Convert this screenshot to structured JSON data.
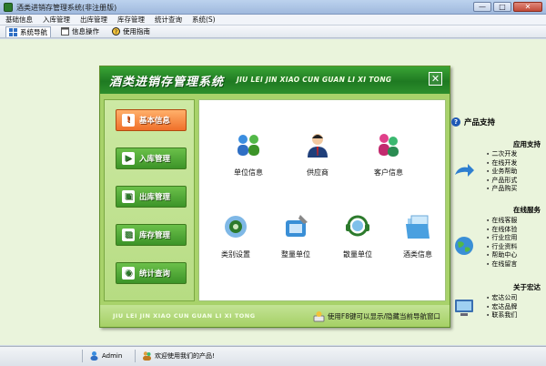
{
  "window": {
    "title": "酒类进销存管理系统(非注册版)",
    "buttons": {
      "minimize": "—",
      "maximize": "□",
      "close": "✕"
    }
  },
  "menu": [
    "基础信息",
    "入库管理",
    "出库管理",
    "库存管理",
    "统计查询",
    "系统(S)"
  ],
  "toolbar": [
    {
      "label": "系统导航",
      "icon": "grid-icon",
      "active": true
    },
    {
      "label": "信息操作",
      "icon": "window-icon",
      "active": false
    },
    {
      "label": "使用指南",
      "icon": "help-icon",
      "active": false
    }
  ],
  "dialog": {
    "title": "酒类进销存管理系统",
    "subtitle": "JIU LEI JIN XIAO CUN GUAN LI XI TONG",
    "close": "✕",
    "nav": [
      {
        "label": "基本信息",
        "selected": true
      },
      {
        "label": "入库管理",
        "selected": false
      },
      {
        "label": "出库管理",
        "selected": false
      },
      {
        "label": "库存管理",
        "selected": false
      },
      {
        "label": "统计查询",
        "selected": false
      }
    ],
    "features_row1": [
      "单位信息",
      "供应商",
      "客户信息"
    ],
    "features_row2": [
      "类别设置",
      "整量单位",
      "散量单位",
      "酒类信息"
    ],
    "footer_pinyin": "JIU LEI JIN XIAO CUN GUAN LI XI TONG",
    "footer_tip": "使用F8键可以显示/隐藏当前导航窗口"
  },
  "sidebar": {
    "title": "产品支持",
    "groups": [
      {
        "title": "应用支持",
        "links": [
          "二次开发",
          "在线开发",
          "业务帮助",
          "产品形式",
          "产品购买"
        ]
      },
      {
        "title": "在线服务",
        "links": [
          "在线客服",
          "在线体验",
          "行业应用",
          "行业资料",
          "帮助中心",
          "在线留言"
        ]
      },
      {
        "title": "关于宏达",
        "links": [
          "宏达公司",
          "宏达品牌",
          "联系我们"
        ]
      }
    ]
  },
  "status": {
    "user": "Admin",
    "message": "欢迎使用我们的产品!"
  },
  "colors": {
    "accent_green": "#2d8f2c",
    "selected_orange": "#f0702a",
    "panel_green": "#a8d26a"
  }
}
